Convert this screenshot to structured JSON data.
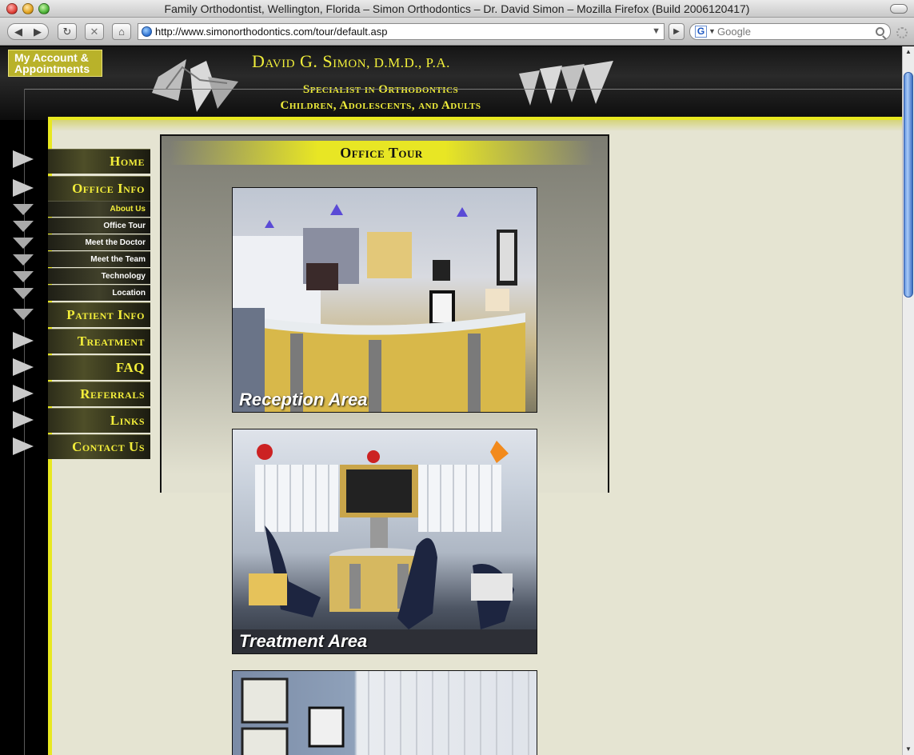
{
  "window": {
    "title": "Family Orthodontist, Wellington, Florida – Simon Orthodontics – Dr. David Simon – Mozilla Firefox (Build 2006120417)"
  },
  "toolbar": {
    "back_icon": "◀",
    "forward_icon": "▶",
    "reload_icon": "↻",
    "stop_icon": "✕",
    "home_icon": "⌂",
    "url": "http://www.simonorthodontics.com/tour/default.asp",
    "search_placeholder": "Google",
    "search_engine_letter": "G"
  },
  "header": {
    "account_button": "My Account & Appointments",
    "name": "David G. Simon",
    "credentials": ", D.M.D., P.A.",
    "subtitle_line1": "Specialist in Orthodontics",
    "subtitle_line2": "Children, Adolescents, and Adults"
  },
  "nav": {
    "home": "Home",
    "office_info": "Office Info",
    "sub": [
      "About Us",
      "Office Tour",
      "Meet the Doctor",
      "Meet the Team",
      "Technology",
      "Location"
    ],
    "patient_info": "Patient Info",
    "treatment": "Treatment",
    "faq": "FAQ",
    "referrals": "Referrals",
    "links": "Links",
    "contact_us": "Contact Us"
  },
  "tour": {
    "heading": "Office Tour",
    "photos": [
      "Reception Area",
      "Treatment Area"
    ]
  },
  "colors": {
    "accent_yellow": "#f0ee3a",
    "content_bg": "#e5e4d2",
    "frame_yellow": "#e8e820"
  }
}
